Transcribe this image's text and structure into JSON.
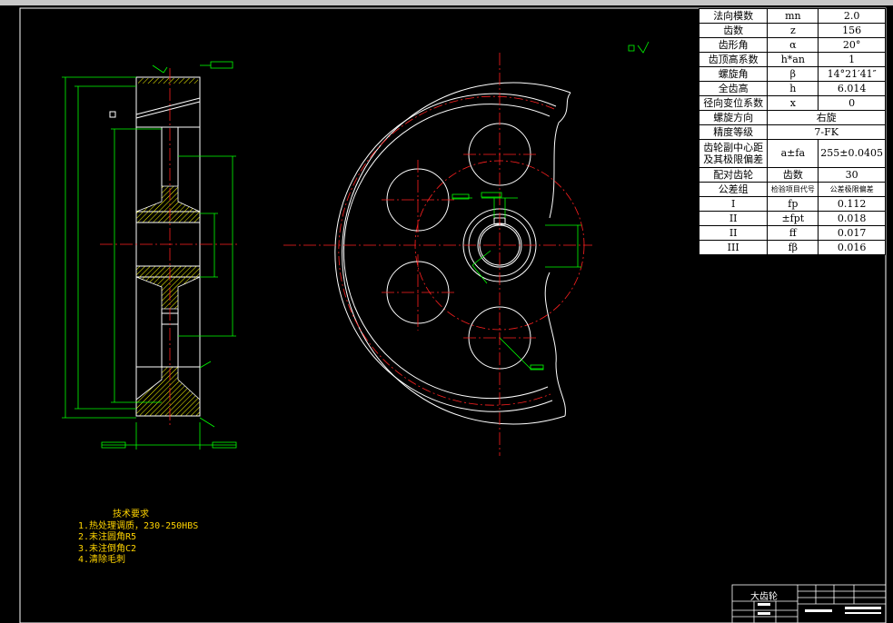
{
  "params_table": {
    "rows": [
      {
        "label": "法向模数",
        "symbol": "mn",
        "value": "2.0"
      },
      {
        "label": "齿数",
        "symbol": "z",
        "value": "156"
      },
      {
        "label": "齿形角",
        "symbol": "α",
        "value": "20°"
      },
      {
        "label": "齿顶高系数",
        "symbol": "h*an",
        "value": "1"
      },
      {
        "label": "螺旋角",
        "symbol": "β",
        "value": "14°21′41″"
      },
      {
        "label": "全齿高",
        "symbol": "h",
        "value": "6.014"
      },
      {
        "label": "径向变位系数",
        "symbol": "x",
        "value": "0"
      }
    ],
    "spiral_label": "螺旋方向",
    "spiral_value": "右旋",
    "precision_label": "精度等级",
    "precision_value": "7-FK",
    "center_label": "齿轮副中心距 及其极限偏差",
    "center_symbol": "a±fa",
    "center_value": "255±0.0405",
    "mating_label": "配对齿轮",
    "mating_sub": "齿数",
    "mating_value": "30",
    "group_label": "公差组",
    "group_col2": "检验项目代号",
    "group_col3": "公差极限偏差",
    "groups": [
      {
        "group": "I",
        "symbol": "fp",
        "value": "0.112"
      },
      {
        "group": "II",
        "symbol": "±fpt",
        "value": "0.018"
      },
      {
        "group": "II",
        "symbol": "ff",
        "value": "0.017"
      },
      {
        "group": "III",
        "symbol": "fβ",
        "value": "0.016"
      }
    ]
  },
  "notes": {
    "title": "技术要求",
    "items": [
      "1.热处理调质，230-250HBS",
      "2.未注圆角R5",
      "3.未注倒角C2",
      "4.清除毛刺"
    ]
  },
  "title_block": {
    "name": "大齿轮"
  },
  "colors": {
    "background": "#000000",
    "outline": "#ffffff",
    "centerline": "#ff2020",
    "dimension": "#00ff00",
    "hatch": "#ffff00",
    "notes": "#ffd400"
  }
}
